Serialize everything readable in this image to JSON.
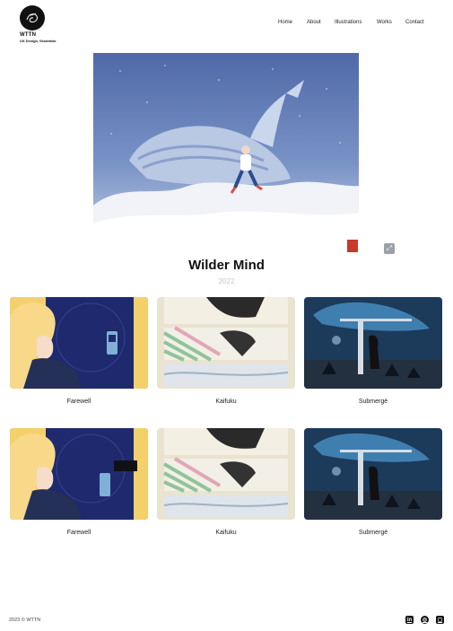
{
  "brand": {
    "name": "WTTN",
    "tagline": "UX Design, Illustrator"
  },
  "nav": {
    "items": [
      "Home",
      "About",
      "Illustrations",
      "Works",
      "Contact"
    ]
  },
  "hero": {
    "title": "Wilder Mind",
    "year": "2022"
  },
  "gallery": {
    "row1": [
      "Farewell",
      "Kaifuku",
      "Submergé"
    ],
    "row2": [
      "Farewell",
      "Kaifuku",
      "Submergé"
    ]
  },
  "footer": {
    "copyright": "2023 © WTTN",
    "social_icons": [
      "linkedin-icon",
      "dribbble-icon",
      "instagram-icon"
    ]
  },
  "colors": {
    "accent": "#111111",
    "year_gray": "#c7c7c7"
  }
}
